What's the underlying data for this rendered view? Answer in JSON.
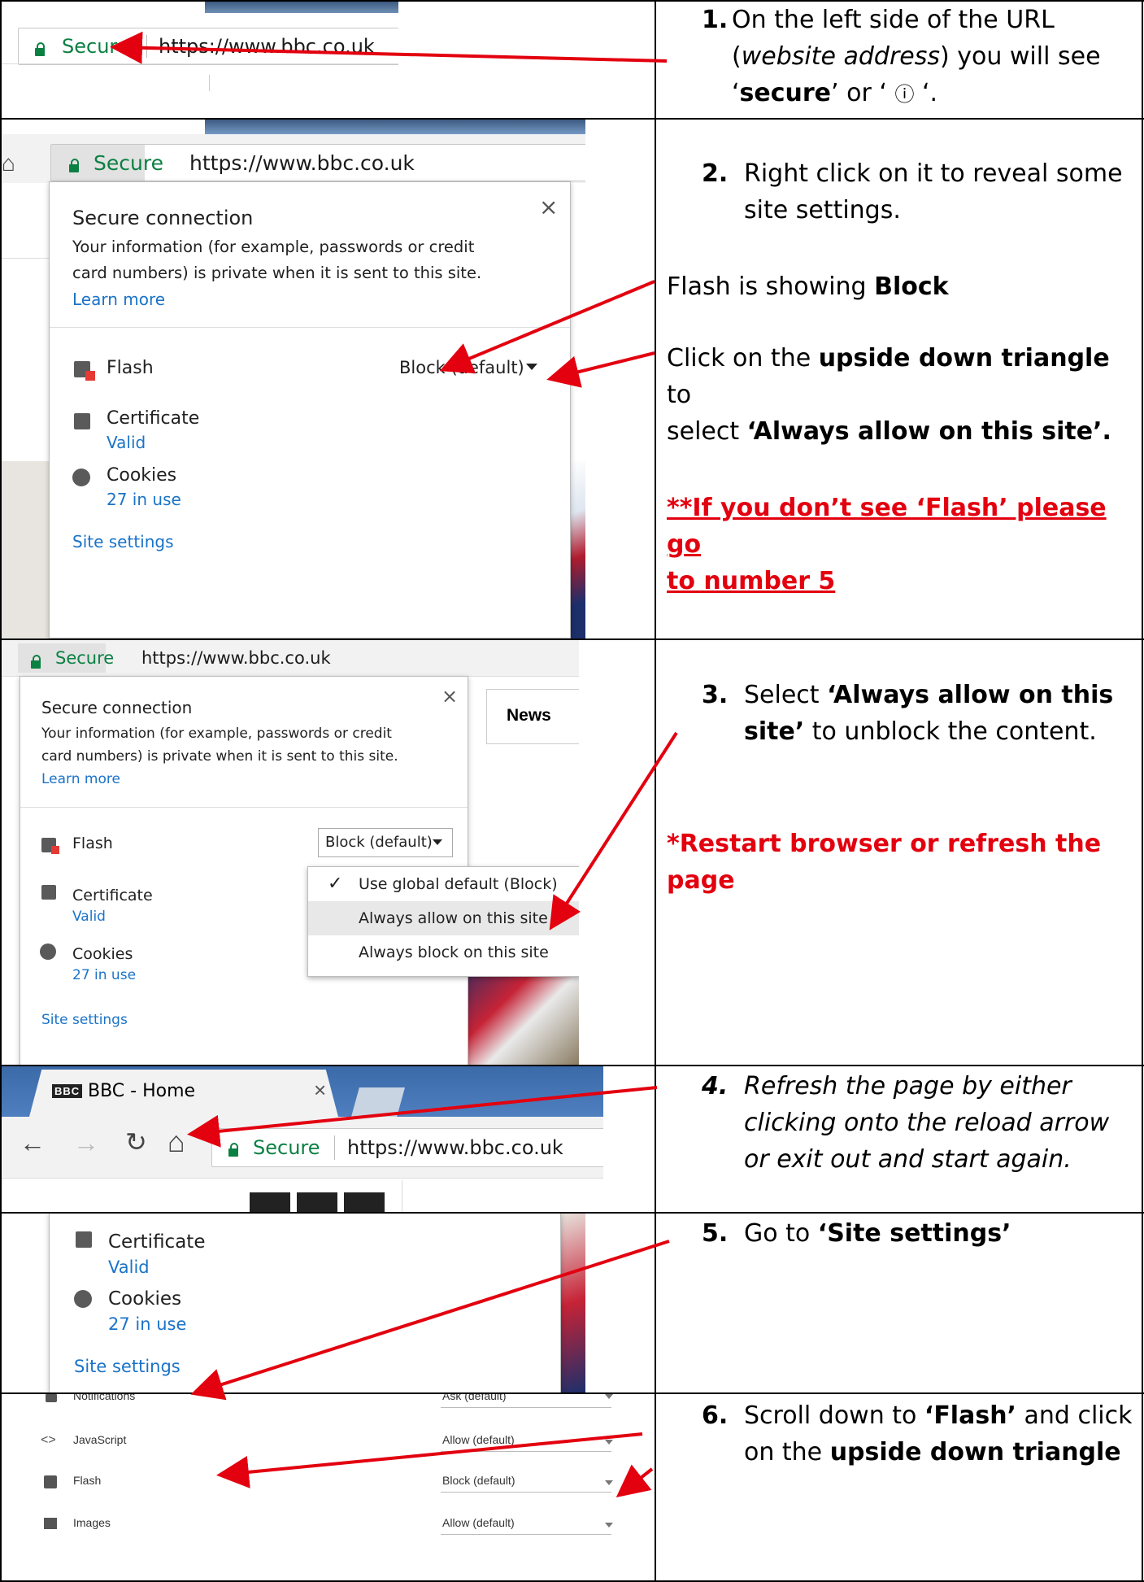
{
  "steps": {
    "s1": {
      "num": "1.",
      "t1": "On the left side of the URL",
      "t2a": "(",
      "t2i": "website address",
      "t2b": ") you will see",
      "q1": "‘",
      "bold": "secure",
      "q2": "’ or ‘",
      "icon": "ⓘ",
      "q3": " ‘."
    },
    "s2": {
      "num": "2.",
      "t1": "Right click on it to reveal some",
      "t2": "site settings.",
      "flash_a": "Flash is showing ",
      "flash_b": "Block",
      "click_a": "Click on the ",
      "click_b": "upside down triangle",
      "click_c": " to",
      "select_a": "select ",
      "select_b": "‘Always allow on this site’.",
      "warn1": "**If you don’t see ‘Flash’ please go",
      "warn2": "to number 5"
    },
    "s3": {
      "num": "3.",
      "t1a": "Select ",
      "t1b": "‘Always allow on this",
      "t2a": "site’",
      "t2b": " to unblock the content.",
      "red1": "*Restart browser or refresh the",
      "red2": "page"
    },
    "s4": {
      "num": "4.",
      "t1": "Refresh the page by either",
      "t2": "clicking onto the reload arrow",
      "t3": "or exit out and start again."
    },
    "s5": {
      "num": "5.",
      "t1a": "Go to ",
      "t1b": "‘Site settings’"
    },
    "s6": {
      "num": "6.",
      "t1a": "Scroll down to ",
      "t1b": "‘Flash’",
      "t1c": " and click",
      "t2a": "on the ",
      "t2b": "upside down triangle"
    }
  },
  "browser": {
    "secure": "Secure",
    "url": "https://www.bbc.co.uk",
    "tab_title": "BBC - Home",
    "tab_logo": "BBC",
    "tab_close": "×"
  },
  "popup": {
    "title": "Secure connection",
    "close": "×",
    "desc1": "Your information (for example, passwords or credit",
    "desc2": "card numbers) is private when it is sent to this site.",
    "learn": "Learn more",
    "flash": "Flash",
    "flash_value": "Block (default)",
    "certificate": "Certificate",
    "cert_value": "Valid",
    "cookies": "Cookies",
    "cookies_value": "27 in use",
    "site_settings": "Site settings"
  },
  "menu": {
    "opt1": "Use global default (Block)",
    "opt2": "Always allow on this site",
    "opt3": "Always block on this site",
    "check": "✓"
  },
  "news_tab": "News",
  "settings_rows": [
    {
      "label": "Notifications",
      "value": "Ask (default)",
      "icon": "bell-icon"
    },
    {
      "label": "JavaScript",
      "value": "Allow (default)",
      "icon": "code-icon"
    },
    {
      "label": "Flash",
      "value": "Block (default)",
      "icon": "puzzle-icon"
    },
    {
      "label": "Images",
      "value": "Allow (default)",
      "icon": "image-icon"
    }
  ],
  "colors": {
    "secure_green": "#0b8043",
    "link_blue": "#1a73c8",
    "annotation_red": "#e3000f"
  }
}
